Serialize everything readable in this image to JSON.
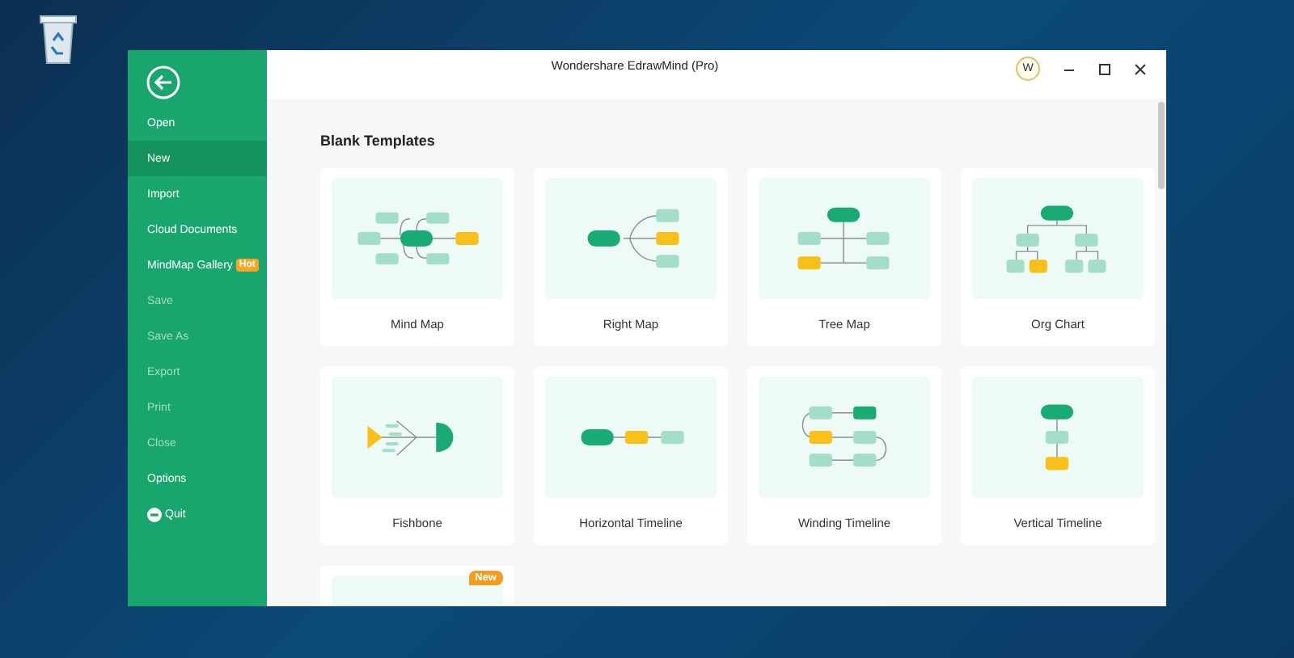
{
  "window": {
    "title": "Wondershare EdrawMind (Pro)",
    "account_initial": "W"
  },
  "sidebar": {
    "items": [
      {
        "label": "Open",
        "kind": "item",
        "selected": false,
        "disabled": false
      },
      {
        "label": "New",
        "kind": "item",
        "selected": true,
        "disabled": false
      },
      {
        "label": "Import",
        "kind": "item",
        "selected": false,
        "disabled": false
      },
      {
        "label": "Cloud Documents",
        "kind": "item",
        "selected": false,
        "disabled": false
      },
      {
        "label": "MindMap Gallery",
        "kind": "item",
        "badge": "Hot",
        "selected": false,
        "disabled": false
      },
      {
        "label": "Save",
        "kind": "item",
        "selected": false,
        "disabled": true
      },
      {
        "label": "Save As",
        "kind": "item",
        "selected": false,
        "disabled": true
      },
      {
        "label": "Export",
        "kind": "item",
        "selected": false,
        "disabled": true
      },
      {
        "label": "Print",
        "kind": "item",
        "selected": false,
        "disabled": true
      },
      {
        "label": "Close",
        "kind": "item",
        "selected": false,
        "disabled": true
      },
      {
        "label": "Options",
        "kind": "item",
        "selected": false,
        "disabled": false
      },
      {
        "label": "Quit",
        "kind": "quit",
        "selected": false,
        "disabled": false
      }
    ]
  },
  "section": {
    "heading": "Blank Templates"
  },
  "templates": [
    {
      "label": "Mind Map",
      "kind": "mind-map"
    },
    {
      "label": "Right Map",
      "kind": "right-map"
    },
    {
      "label": "Tree Map",
      "kind": "tree-map"
    },
    {
      "label": "Org Chart",
      "kind": "org-chart"
    },
    {
      "label": "Fishbone",
      "kind": "fishbone"
    },
    {
      "label": "Horizontal Timeline",
      "kind": "horizontal-timeline"
    },
    {
      "label": "Winding Timeline",
      "kind": "winding-timeline"
    },
    {
      "label": "Vertical Timeline",
      "kind": "vertical-timeline"
    },
    {
      "kind": "hidden",
      "badge": "New"
    }
  ]
}
